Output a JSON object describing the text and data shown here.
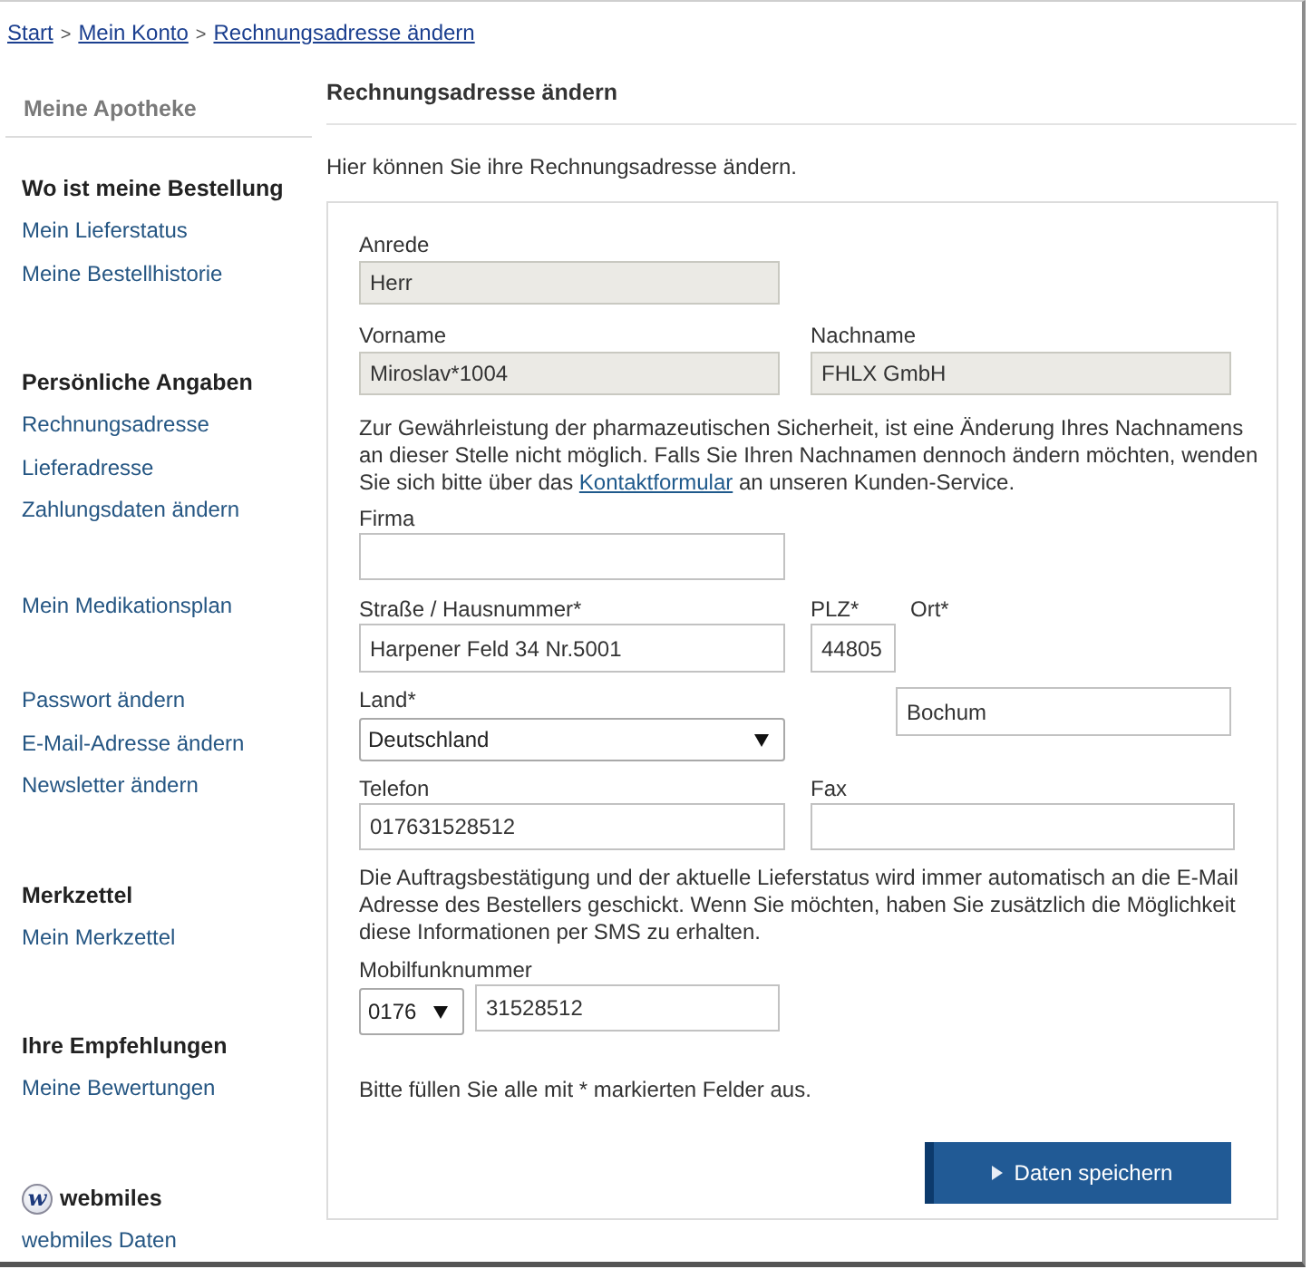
{
  "breadcrumb": [
    {
      "kind": "link",
      "text": "Start"
    },
    {
      "kind": "separator",
      "text": ">"
    },
    {
      "kind": "link",
      "text": "Mein Konto"
    },
    {
      "kind": "separator",
      "text": ">"
    },
    {
      "kind": "link",
      "text": "Rechnungsadresse ändern"
    }
  ],
  "sidebar": {
    "title": "Meine Apotheke",
    "groups": [
      {
        "heading": "Wo ist meine Bestellung",
        "links": [
          "Mein Lieferstatus",
          "Meine Bestellhistorie"
        ]
      },
      {
        "heading": "Persönliche Angaben",
        "links": [
          "Rechnungsadresse",
          "Lieferadresse",
          "Zahlungsdaten ändern"
        ]
      },
      {
        "links": [
          "Mein Medikationsplan"
        ]
      },
      {
        "links": [
          "Passwort ändern",
          "E-Mail-Adresse ändern",
          "Newsletter ändern"
        ]
      },
      {
        "heading": "Merkzettel",
        "links": [
          "Mein Merkzettel"
        ]
      },
      {
        "heading": "Ihre Empfehlungen",
        "links": [
          "Meine Bewertungen"
        ]
      },
      {
        "logo": "w",
        "heading": "webmiles",
        "links": [
          "webmiles Daten"
        ]
      }
    ]
  },
  "main": {
    "title": "Rechnungsadresse ändern",
    "intro": "Hier können Sie ihre Rechnungsadresse ändern."
  },
  "form": {
    "salutation": {
      "label": "Anrede",
      "value": "Herr",
      "disabled": true
    },
    "first_name": {
      "label": "Vorname",
      "value": "Miroslav*1004",
      "disabled": true
    },
    "last_name": {
      "label": "Nachname",
      "value": "FHLX GmbH",
      "disabled": true
    },
    "name_notice": {
      "before": "Zur Gewährleistung der pharmazeutischen Sicherheit, ist eine Änderung Ihres Nachnamens an dieser Stelle nicht möglich. Falls Sie Ihren Nachnamen dennoch ändern möchten, wenden Sie sich bitte über das",
      "link": "Kontaktformular",
      "after": "an unseren Kunden-Service."
    },
    "company": {
      "label": "Firma",
      "disabled": false
    },
    "street": {
      "label": "Straße / Hausnummer*",
      "value": "Harpener Feld 34 Nr.5001",
      "disabled": false
    },
    "zip": {
      "label": "PLZ*",
      "value": "44805",
      "disabled": false
    },
    "city": {
      "label": "Ort*",
      "value": "Bochum",
      "disabled": false
    },
    "country": {
      "label": "Land*",
      "value": "Deutschland",
      "disabled": false
    },
    "phone": {
      "label": "Telefon",
      "value": "017631528512",
      "disabled": false
    },
    "fax": {
      "label": "Fax",
      "disabled": false
    },
    "sms_notice": "Die Auftragsbestätigung und der aktuelle Lieferstatus wird immer automatisch an die E-Mail Adresse des Bestellers geschickt. Wenn Sie möchten, haben Sie zusätzlich die Möglichkeit diese Informationen per SMS zu erhalten.",
    "mobile": {
      "label": "Mobilfunknummer",
      "prefix": "0176",
      "value": "31528512",
      "disabled": false
    },
    "required_hint": "Bitte füllen Sie alle mit * markierten Felder aus.",
    "submit": "Daten speichern"
  }
}
